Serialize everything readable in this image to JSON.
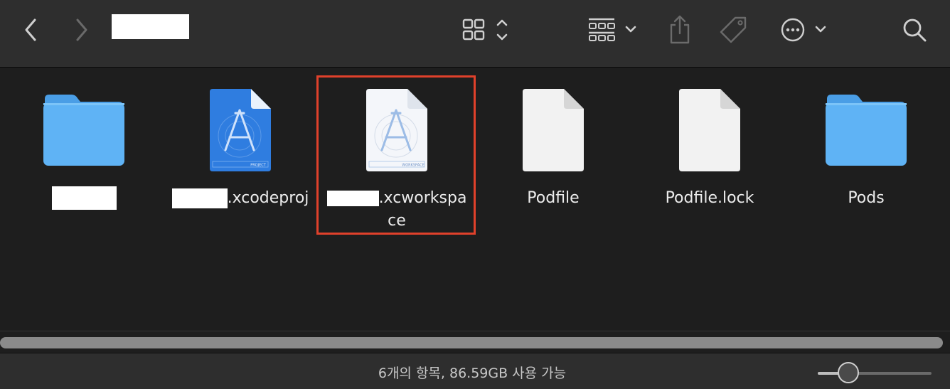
{
  "toolbar": {
    "back_icon": "chevron-left-icon",
    "forward_icon": "chevron-right-icon",
    "view_icon": "grid-view-icon",
    "group_icon": "group-by-icon",
    "share_icon": "share-icon",
    "tag_icon": "tag-icon",
    "more_icon": "more-icon",
    "search_icon": "search-icon"
  },
  "files": [
    {
      "name": "",
      "suffix": "",
      "type": "folder"
    },
    {
      "name": "",
      "suffix": ".xcodeproj",
      "type": "xcodeproj",
      "badge": "PROJECT"
    },
    {
      "name": "",
      "suffix": ".xcworkspa",
      "suffix2": "ce",
      "type": "xcworkspace",
      "badge": "WORKSPACE",
      "highlighted": true
    },
    {
      "name": "Podfile",
      "type": "document"
    },
    {
      "name": "Podfile.lock",
      "type": "document"
    },
    {
      "name": "Pods",
      "type": "folder"
    }
  ],
  "status": {
    "text": "6개의 항목, 86.59GB 사용 가능",
    "zoom_level": 0.27
  },
  "colors": {
    "highlight": "#e0412b",
    "folder": "#5fb3f5",
    "project_blue": "#2f7de0"
  }
}
